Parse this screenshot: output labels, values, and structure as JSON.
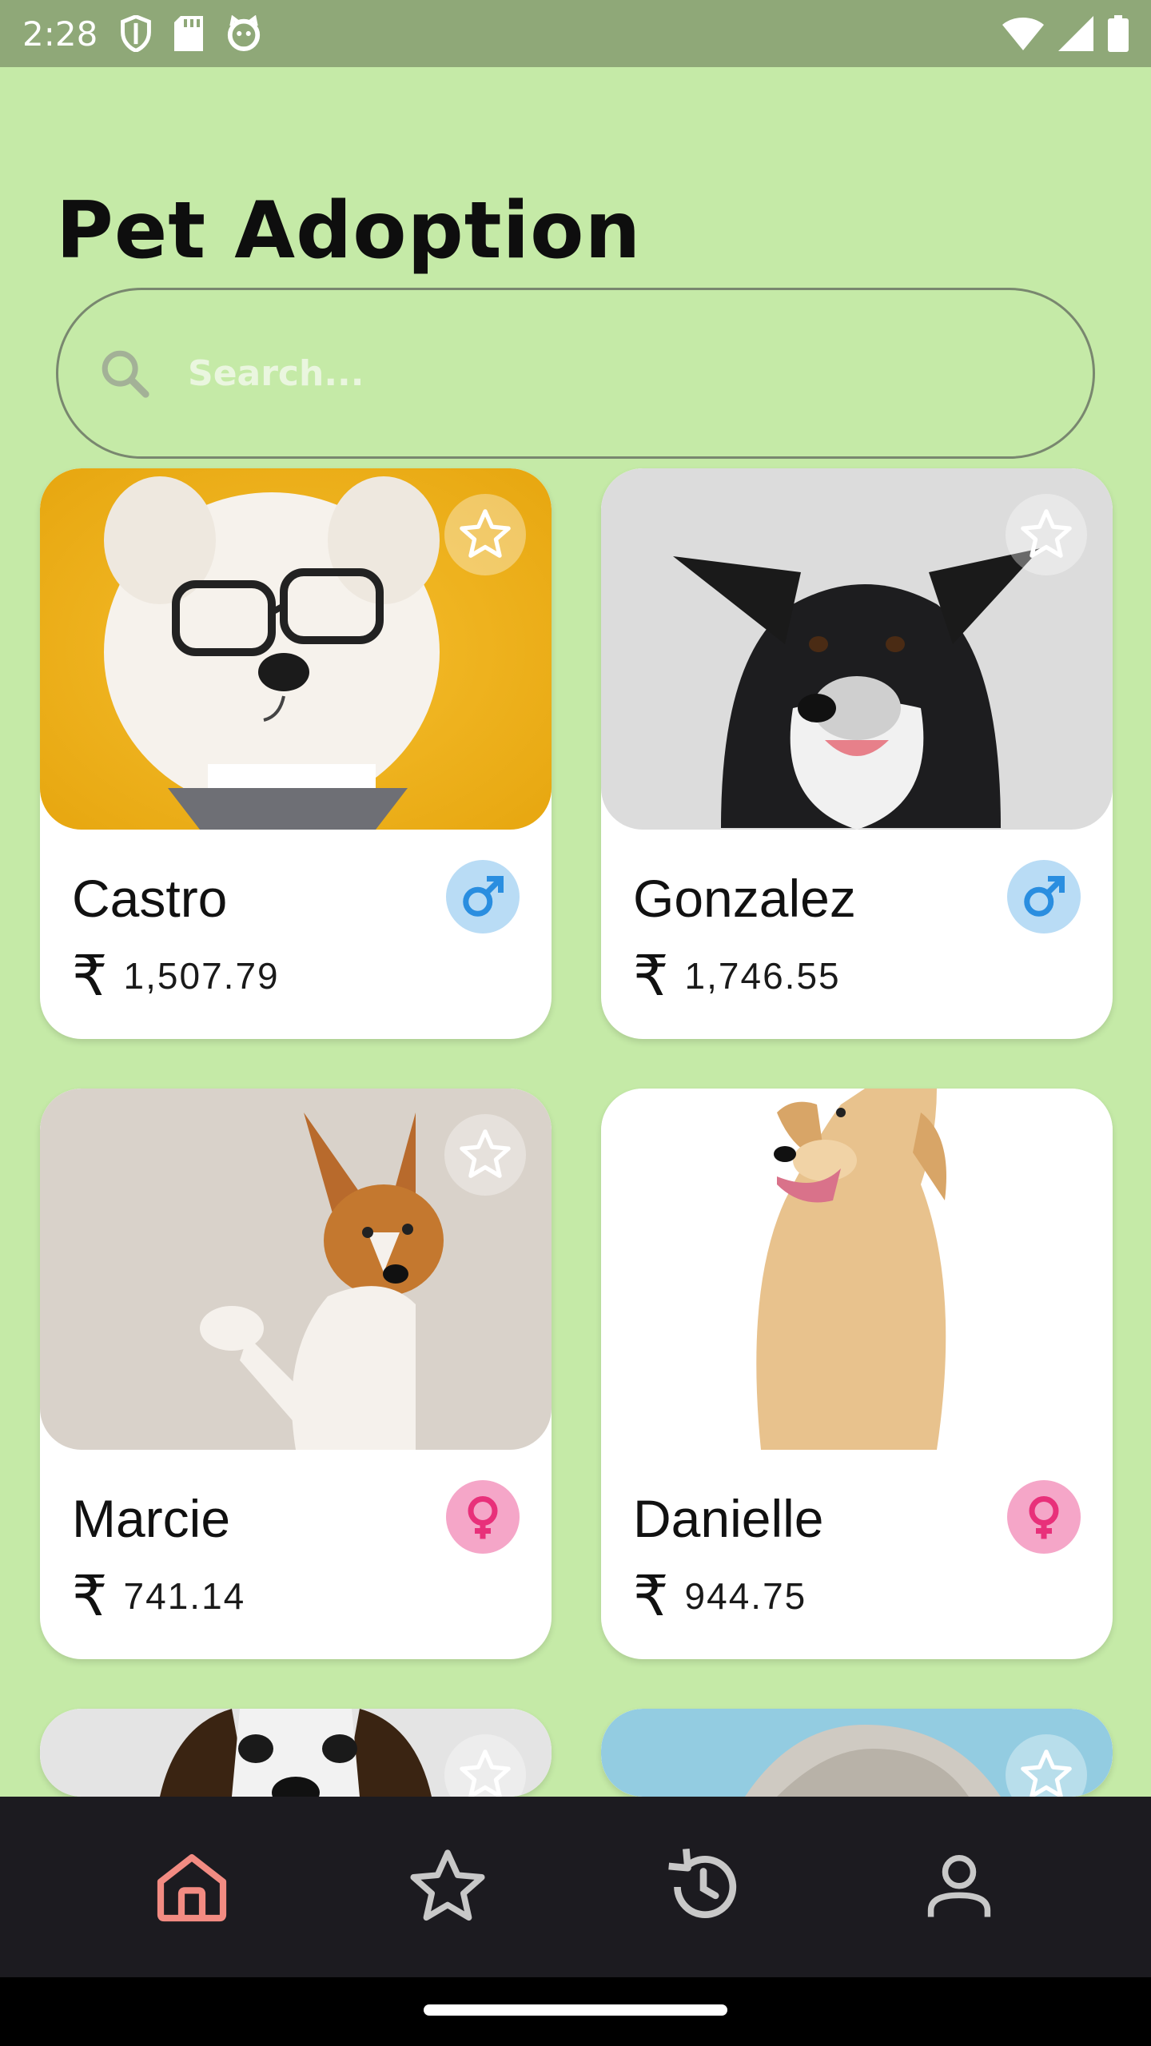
{
  "status_bar": {
    "time": "2:28"
  },
  "header": {
    "title": "Pet Adoption"
  },
  "search": {
    "placeholder": "Search..."
  },
  "pets": [
    {
      "name": "Castro",
      "price": "1,507.79",
      "currency": "₹",
      "gender": "male"
    },
    {
      "name": "Gonzalez",
      "price": "1,746.55",
      "currency": "₹",
      "gender": "male"
    },
    {
      "name": "Marcie",
      "price": "741.14",
      "currency": "₹",
      "gender": "female"
    },
    {
      "name": "Danielle",
      "price": "944.75",
      "currency": "₹",
      "gender": "female"
    }
  ],
  "bottom_nav": {
    "items": [
      {
        "icon": "home-icon",
        "active": true
      },
      {
        "icon": "star-icon",
        "active": false
      },
      {
        "icon": "history-icon",
        "active": false
      },
      {
        "icon": "person-icon",
        "active": false
      }
    ]
  },
  "colors": {
    "background": "#c5eaa7",
    "nav_active": "#f28b82",
    "male": "#2a8ee0",
    "female": "#e8307a",
    "nav_bg": "#1c1b20"
  }
}
